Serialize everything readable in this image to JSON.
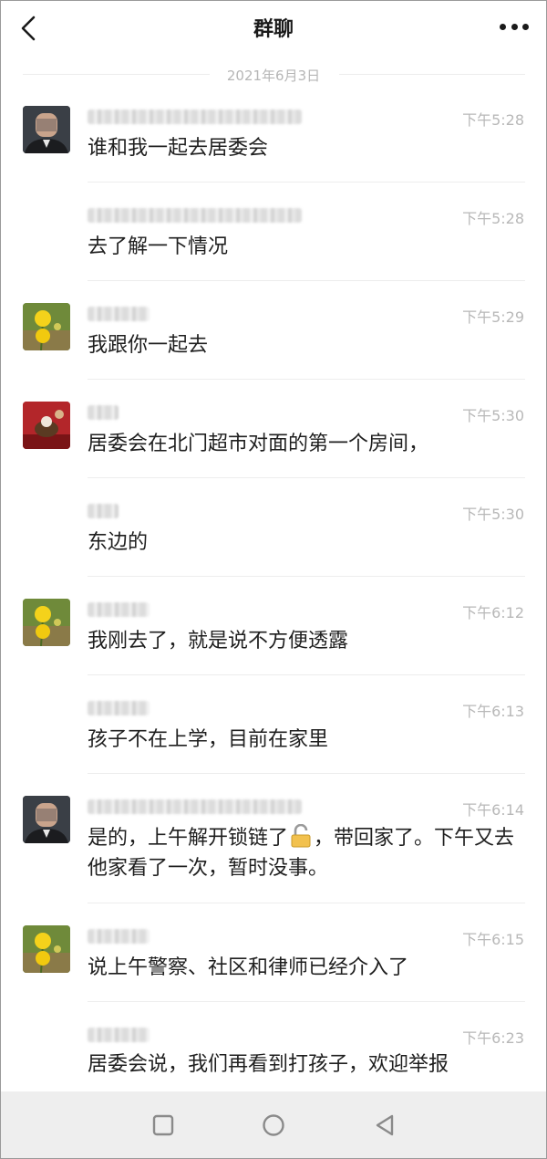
{
  "header": {
    "title": "群聊",
    "back_icon": "chevron-left-icon",
    "more_icon": "more-dots-icon"
  },
  "date_divider": "2021年6月3日",
  "messages": [
    {
      "avatar": "person",
      "time": "下午5:28",
      "text": "谁和我一起去居委会"
    },
    {
      "avatar": "",
      "time": "下午5:28",
      "text": "去了解一下情况"
    },
    {
      "avatar": "flower",
      "time": "下午5:29",
      "text": "我跟你一起去"
    },
    {
      "avatar": "tea",
      "time": "下午5:30",
      "text": "居委会在北门超市对面的第一个房间，"
    },
    {
      "avatar": "",
      "time": "下午5:30",
      "text": "东边的"
    },
    {
      "avatar": "flower",
      "time": "下午6:12",
      "text": "我刚去了，就是说不方便透露"
    },
    {
      "avatar": "",
      "time": "下午6:13",
      "text": "孩子不在上学，目前在家里"
    },
    {
      "avatar": "person",
      "time": "下午6:14",
      "text_before": "是的，上午解开锁链了",
      "text_after": "，带回家了。下午又去他家看了一次，暂时没事。",
      "emoji": "unlock-icon"
    },
    {
      "avatar": "flower",
      "time": "下午6:15",
      "text": "说上午警察、社区和律师已经介入了"
    },
    {
      "avatar": "",
      "time": "下午6:23",
      "text": "居委会说，我们再看到打孩子，欢迎举报"
    }
  ],
  "nav": {
    "recents_icon": "square-icon",
    "home_icon": "circle-icon",
    "back_icon": "triangle-back-icon"
  }
}
